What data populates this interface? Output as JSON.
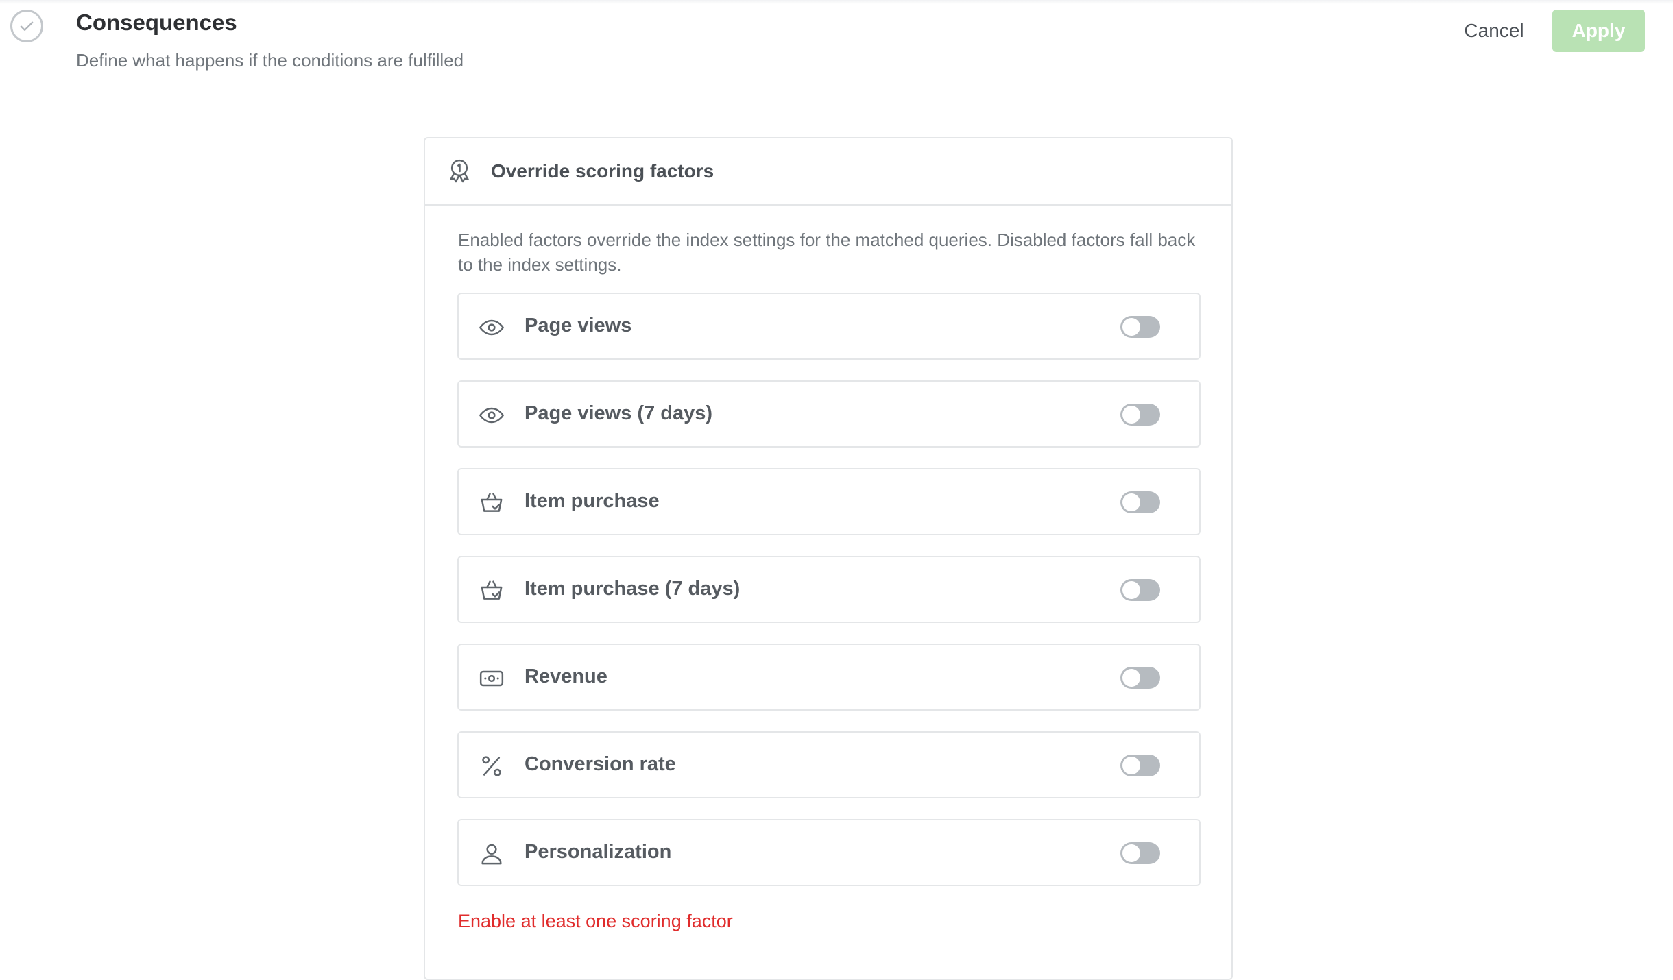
{
  "header": {
    "title": "Consequences",
    "subtitle": "Define what happens if the conditions are fulfilled",
    "cancel_label": "Cancel",
    "apply_label": "Apply"
  },
  "card": {
    "title": "Override scoring factors",
    "icon": "award-ribbon-icon",
    "description": "Enabled factors override the index settings for the matched queries. Disabled factors fall back to the index settings.",
    "factors": [
      {
        "label": "Page views",
        "icon": "eye-icon",
        "enabled": false
      },
      {
        "label": "Page views (7 days)",
        "icon": "eye-icon",
        "enabled": false
      },
      {
        "label": "Item purchase",
        "icon": "basket-icon",
        "enabled": false
      },
      {
        "label": "Item purchase (7 days)",
        "icon": "basket-icon",
        "enabled": false
      },
      {
        "label": "Revenue",
        "icon": "cash-icon",
        "enabled": false
      },
      {
        "label": "Conversion rate",
        "icon": "percent-icon",
        "enabled": false
      },
      {
        "label": "Personalization",
        "icon": "user-icon",
        "enabled": false
      }
    ],
    "error": "Enable at least one scoring factor"
  },
  "colors": {
    "apply_disabled": "#b9e2b4",
    "toggle_off": "#b6bbc0",
    "error": "#e02c2c"
  }
}
